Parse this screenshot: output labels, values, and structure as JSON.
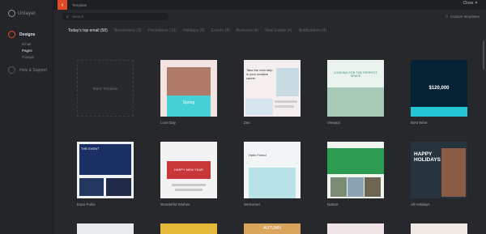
{
  "app": {
    "brand": "Unlayer"
  },
  "sidebar": {
    "items": [
      {
        "label": "Designs",
        "active": true
      },
      {
        "label": "Help & Support",
        "active": false
      }
    ],
    "sub_items": [
      "Email",
      "Pages",
      "Popups"
    ]
  },
  "topbar": {
    "title": "Template",
    "close_label": "Close ✕"
  },
  "search": {
    "placeholder": "Search"
  },
  "right_link": {
    "label": "Custom templates"
  },
  "categories": {
    "active": "Today's top email (58)",
    "others": [
      "Newsletters (3)",
      "Promotions (10)",
      "Holidays (8)",
      "Events (4)",
      "Business (4)",
      "Real Estate (4)",
      "Notifications (4)"
    ]
  },
  "cards": [
    {
      "name": "",
      "blank_text": "Blank Template"
    },
    {
      "name": "Love Day"
    },
    {
      "name": "Zen"
    },
    {
      "name": "Viewpol"
    },
    {
      "name": "Best Wine"
    },
    {
      "name": "Expo Pulse"
    },
    {
      "name": "Wonderful Wishes"
    },
    {
      "name": "Welcomer"
    },
    {
      "name": "Nature"
    },
    {
      "name": "All Holidays"
    }
  ],
  "card_text": {
    "zen_heading": "Take the next step in your creative career",
    "viewpol_heading": "LOOKING FOR THE PERFECT SPACE",
    "wine_price": "$120,000",
    "expo_title": "THE EVENT",
    "wishes_title": "HAPPY NEW YEAR",
    "welcomer_title": "Hello Friend",
    "holidays_title": "HAPPY HOLIDAYS",
    "spring_label": "Spring",
    "autumn_label": "AUTUMN"
  },
  "colors": {
    "accent": "#e04a24"
  }
}
